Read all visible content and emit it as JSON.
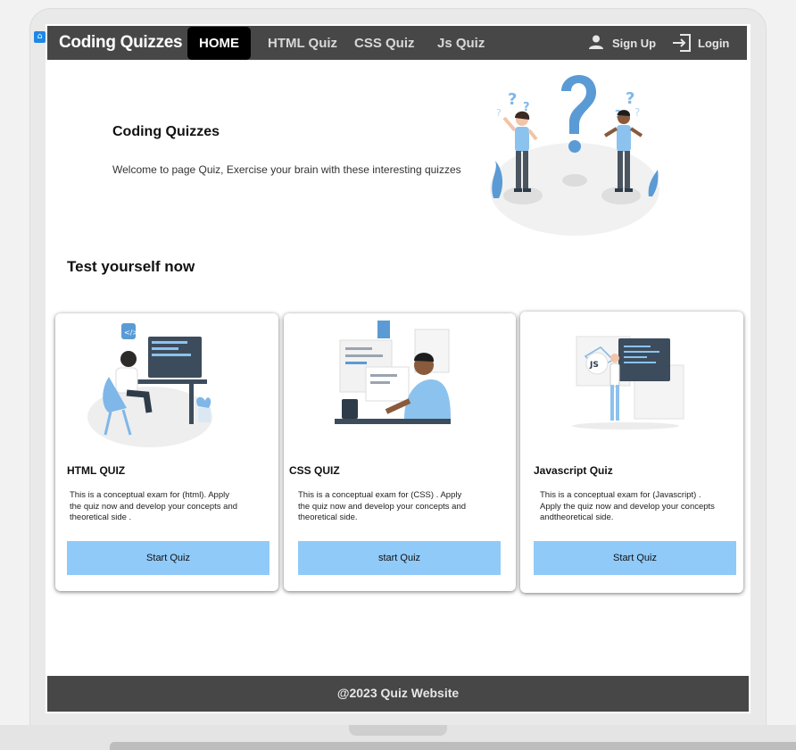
{
  "navbar": {
    "brand": "Coding Quizzes",
    "links": [
      "HOME",
      "HTML Quiz",
      "CSS Quiz",
      "Js Quiz"
    ],
    "signup": "Sign Up",
    "login": "Login",
    "icons": [
      "user-icon",
      "login-icon"
    ]
  },
  "hero": {
    "title": "Coding Quizzes",
    "text": "Welcome to page Quiz, Exercise your brain with these interesting quizzes"
  },
  "section_title": "Test yourself now",
  "cards": [
    {
      "title": "HTML QUIZ",
      "desc_lines": [
        "This is a conceptual exam for (html). Apply",
        "the quiz now and develop your concepts and",
        "theoretical side ."
      ],
      "button": "Start Quiz"
    },
    {
      "title": "CSS QUIZ",
      "desc_lines": [
        "This is a conceptual exam for (CSS) . Apply",
        "the quiz now and develop your concepts and",
        "theoretical side."
      ],
      "button": "start Quiz"
    },
    {
      "title": "Javascript Quiz",
      "desc_lines": [
        "This is a conceptual exam for (Javascript) .",
        "Apply the quiz now and develop your concepts",
        "andtheoretical side."
      ],
      "button": "Start Quiz"
    }
  ],
  "footer": "@2023 Quiz Website",
  "colors": {
    "navbar": "#474747",
    "active_tab": "#000000",
    "button": "#90caf9",
    "accent_blue": "#5b9bd5"
  }
}
